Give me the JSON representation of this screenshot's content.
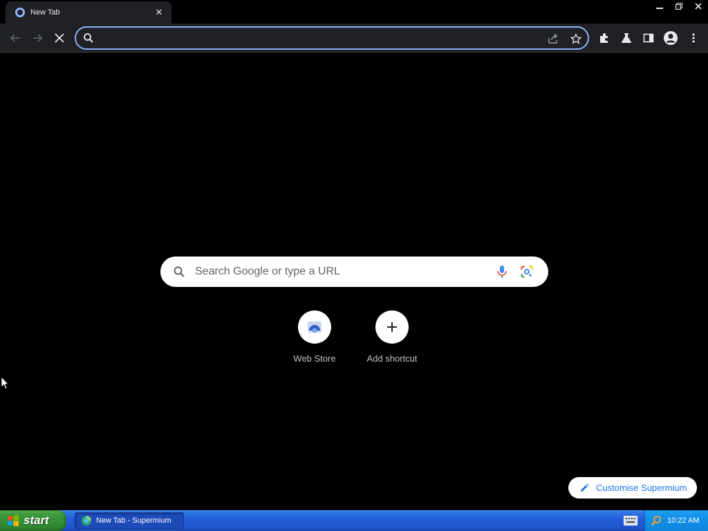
{
  "browser": {
    "tab": {
      "title": "New Tab"
    },
    "omnibox": {
      "value": "",
      "placeholder": ""
    }
  },
  "ntp": {
    "search_placeholder": "Search Google or type a URL",
    "shortcuts": [
      {
        "label": "Web Store",
        "icon": "web-store-icon"
      },
      {
        "label": "Add shortcut",
        "icon": "plus-icon"
      }
    ],
    "customise_label": "Customise Supermium"
  },
  "taskbar": {
    "start_label": "start",
    "task_label": "New Tab - Supermium",
    "clock": "10:22 AM"
  },
  "colors": {
    "focus_ring": "#8ab4f8",
    "accent_blue": "#1a73e8",
    "taskbar_blue": "#245edb",
    "start_green": "#3c9a3c"
  }
}
